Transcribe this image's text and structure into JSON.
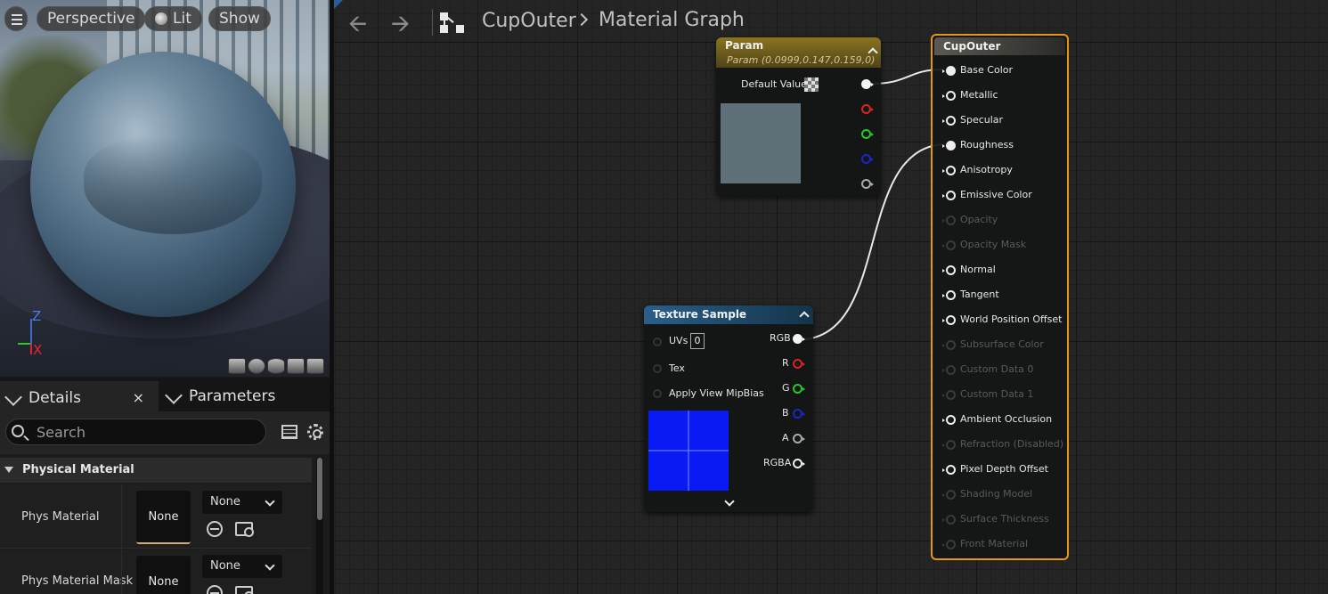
{
  "viewport": {
    "buttons": {
      "perspective": "Perspective",
      "lit": "Lit",
      "show": "Show"
    },
    "axis": {
      "z": "Z",
      "x": "X"
    }
  },
  "details": {
    "tabs": {
      "details": "Details",
      "close": "×",
      "parameters": "Parameters"
    },
    "search_placeholder": "Search",
    "category": "Physical Material",
    "rows": [
      {
        "label": "Phys Material",
        "thumb": "None",
        "combo": "None"
      },
      {
        "label": "Phys Material Mask",
        "thumb": "None",
        "combo": "None"
      }
    ]
  },
  "breadcrumb": {
    "asset": "CupOuter",
    "graph": "Material Graph"
  },
  "nodes": {
    "param": {
      "title": "Param",
      "subtitle": "Param (0.0999,0.147,0.159,0)",
      "default_value_label": "Default Value",
      "swatch_color": "#5f7078"
    },
    "texture_sample": {
      "title": "Texture Sample",
      "inputs": [
        "UVs",
        "Tex",
        "Apply View MipBias"
      ],
      "uvs_value": "0",
      "outputs": [
        "RGB",
        "R",
        "G",
        "B",
        "A",
        "RGBA"
      ]
    },
    "cup_outer": {
      "title": "CupOuter",
      "pins": [
        {
          "label": "Base Color",
          "active": true,
          "connected": true
        },
        {
          "label": "Metallic",
          "active": true,
          "connected": false
        },
        {
          "label": "Specular",
          "active": true,
          "connected": false
        },
        {
          "label": "Roughness",
          "active": true,
          "connected": true
        },
        {
          "label": "Anisotropy",
          "active": true,
          "connected": false
        },
        {
          "label": "Emissive Color",
          "active": true,
          "connected": false
        },
        {
          "label": "Opacity",
          "active": false,
          "connected": false
        },
        {
          "label": "Opacity Mask",
          "active": false,
          "connected": false
        },
        {
          "label": "Normal",
          "active": true,
          "connected": false
        },
        {
          "label": "Tangent",
          "active": true,
          "connected": false
        },
        {
          "label": "World Position Offset",
          "active": true,
          "connected": false
        },
        {
          "label": "Subsurface Color",
          "active": false,
          "connected": false
        },
        {
          "label": "Custom Data 0",
          "active": false,
          "connected": false
        },
        {
          "label": "Custom Data 1",
          "active": false,
          "connected": false
        },
        {
          "label": "Ambient Occlusion",
          "active": true,
          "connected": false
        },
        {
          "label": "Refraction (Disabled)",
          "active": false,
          "connected": false
        },
        {
          "label": "Pixel Depth Offset",
          "active": true,
          "connected": false
        },
        {
          "label": "Shading Model",
          "active": false,
          "connected": false
        },
        {
          "label": "Surface Thickness",
          "active": false,
          "connected": false
        },
        {
          "label": "Front Material",
          "active": false,
          "connected": false
        }
      ]
    }
  },
  "colors": {
    "accent_selected": "#e89612",
    "texture_preview": "#0a1af5",
    "param_header": "#8a7420",
    "texture_header": "#2a5f8a"
  }
}
